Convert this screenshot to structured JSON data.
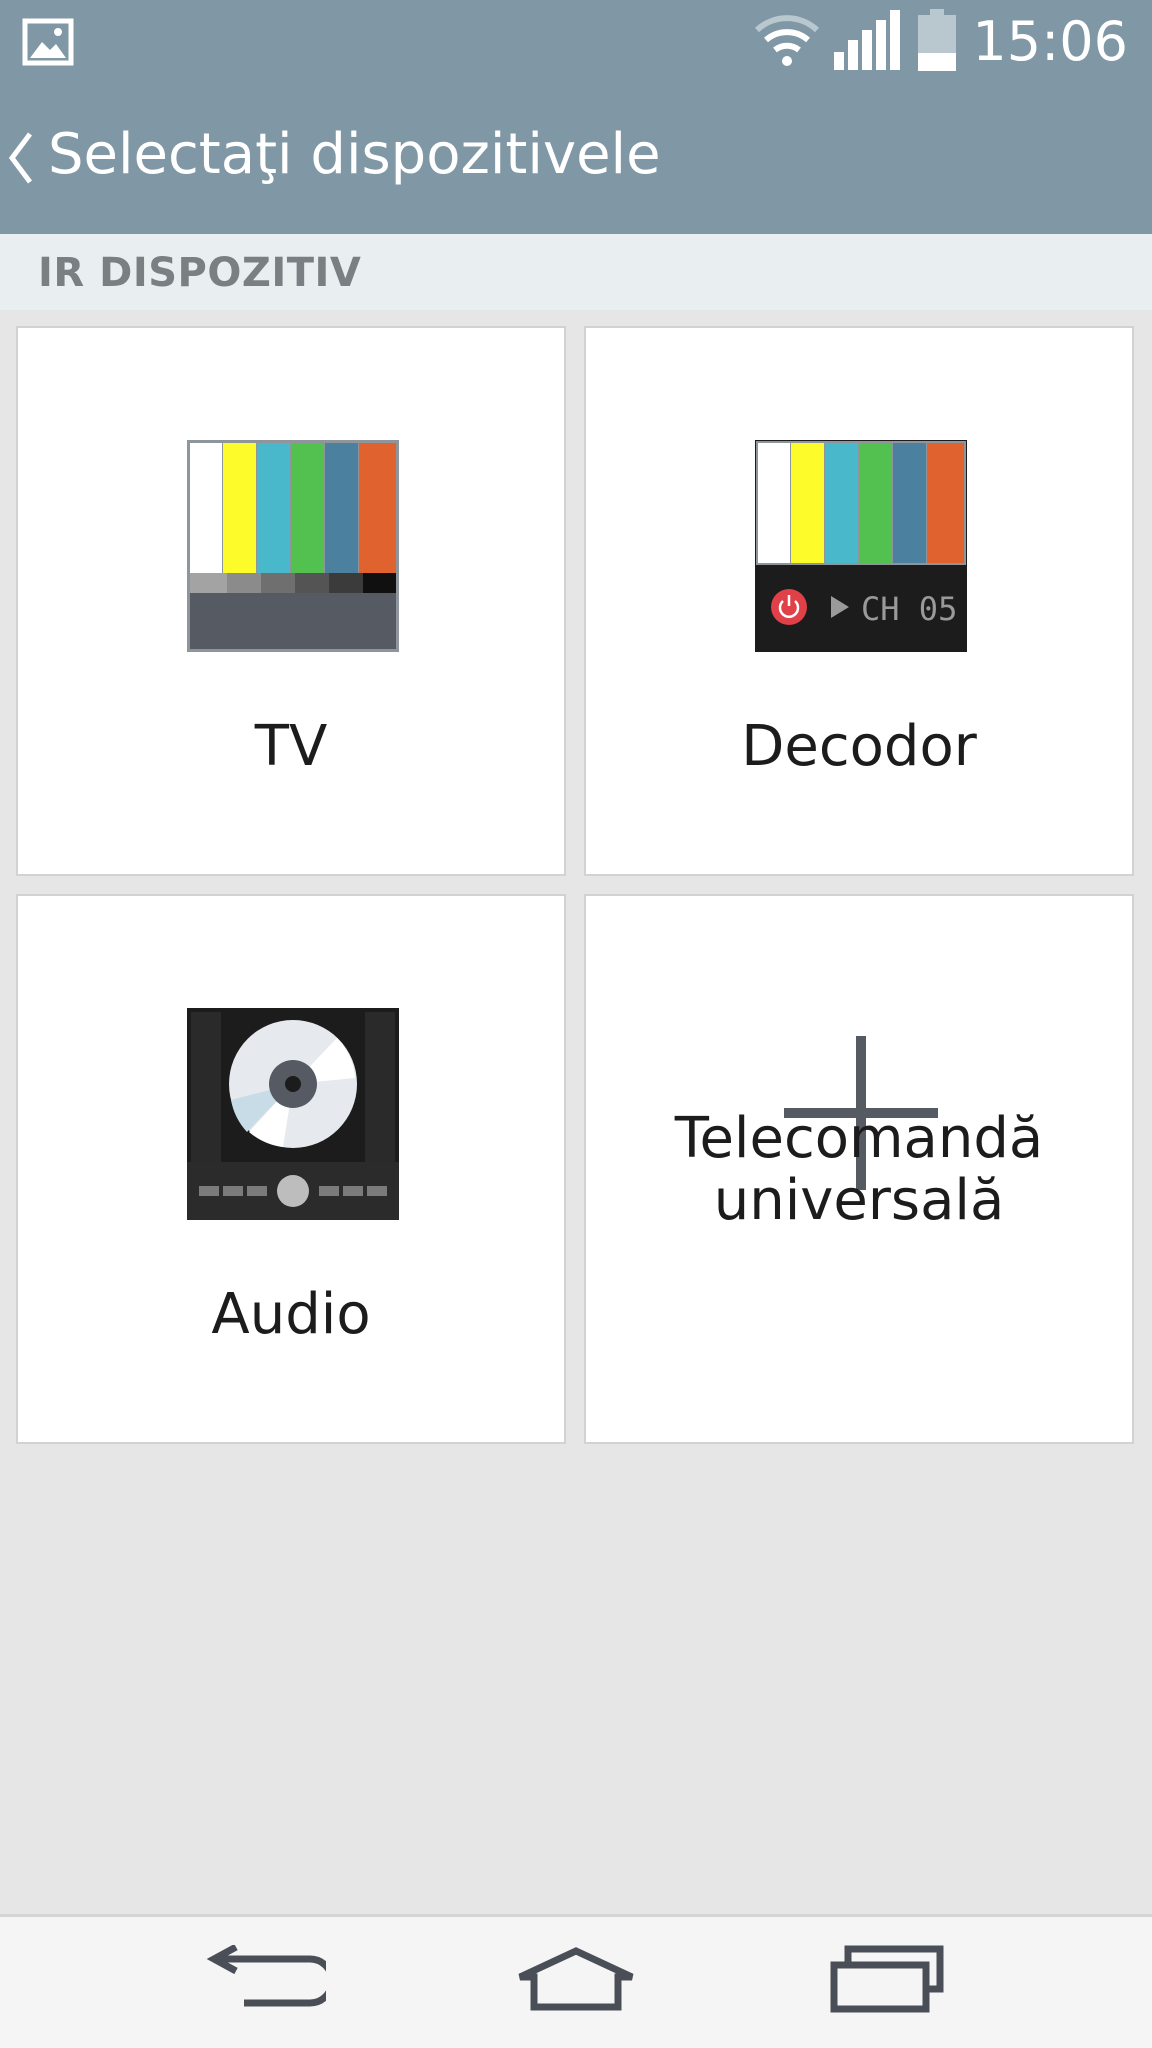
{
  "status_bar": {
    "time": "15:06",
    "icons": [
      "gallery-icon",
      "wifi-icon",
      "signal-icon",
      "battery-icon"
    ]
  },
  "action_bar": {
    "title": "Selectaţi dispozitivele"
  },
  "section": {
    "label": "IR DISPOZITIV"
  },
  "devices": [
    {
      "label": "TV",
      "icon": "tv-color-bars-icon"
    },
    {
      "label": "Decodor",
      "icon": "set-top-box-icon",
      "display_text": "CH 05"
    },
    {
      "label": "Audio",
      "icon": "audio-cd-player-icon"
    },
    {
      "label_line1": "Telecomandă",
      "label_line2": "universală",
      "icon": "plus-icon"
    }
  ],
  "colors": {
    "bar_bg": "#8097a5",
    "page_bg": "#e6e6e6",
    "section_bg": "#e9eef1",
    "color_bars": [
      "#ffffff",
      "#fdfb2a",
      "#4ab8cb",
      "#52c14f",
      "#4b819f",
      "#e0632f"
    ]
  },
  "nav_bar": {
    "buttons": [
      "back-icon",
      "home-icon",
      "recent-apps-icon"
    ]
  }
}
